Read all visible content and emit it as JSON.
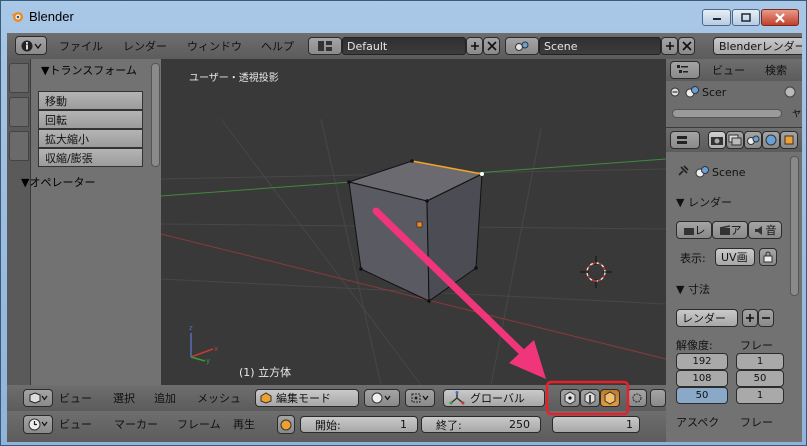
{
  "window": {
    "title": "Blender"
  },
  "top_header": {
    "menus": [
      "ファイル",
      "レンダー",
      "ウィンドウ",
      "ヘルプ"
    ],
    "screen_layout": "Default",
    "scene": "Scene",
    "render_engine": "Blenderレンダー"
  },
  "tool_shelf": {
    "transform_header": "▼トランスフォーム",
    "buttons": [
      "移動",
      "回転",
      "拡大縮小",
      "収縮/膨張"
    ],
    "operator_header": "▼オペレーター"
  },
  "viewport": {
    "view_label": "ユーザー・透視投影",
    "object_label": "(1) 立方体"
  },
  "viewport_header": {
    "menus": [
      "ビュー",
      "選択",
      "追加",
      "メッシュ"
    ],
    "mode": "編集モード",
    "orientation": "グローバル"
  },
  "timeline": {
    "menus": [
      "ビュー",
      "マーカー",
      "フレーム",
      "再生"
    ],
    "start_label": "開始:",
    "start_value": "1",
    "end_label": "終了:",
    "end_value": "250",
    "current": "1"
  },
  "outliner": {
    "menu_view": "ビュー",
    "menu_search": "検索",
    "item": "Scer",
    "cut_text": "ャ"
  },
  "properties": {
    "scene": "Scene",
    "render_header": "▼ レンダー",
    "render_buttons": [
      "レ",
      "ア",
      "音"
    ],
    "display_label": "表示:",
    "display_value": "UV画",
    "dimensions_header": "▼ 寸法",
    "preset": "レンダー",
    "resolution_label": "解像度:",
    "frame_label": "フレー",
    "res_x": "192",
    "res_y": "108",
    "res_pct": "50",
    "frame_start": "1",
    "frame_end": "50",
    "frame_step": "1",
    "aspect_label": "アスペク",
    "frame_rate_label": "フレー"
  },
  "colors": {
    "highlight": "#e8202a",
    "arrow": "#f0357a",
    "selected_edge": "#f5a623"
  }
}
